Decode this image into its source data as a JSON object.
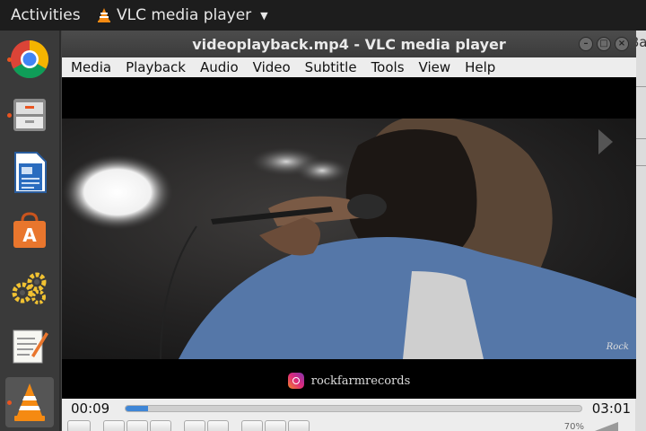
{
  "topbar": {
    "activities": "Activities",
    "app_name": "VLC media player"
  },
  "dock": {
    "items": [
      {
        "icon": "chrome-icon"
      },
      {
        "icon": "file-cabinet-icon"
      },
      {
        "icon": "writer-document-icon"
      },
      {
        "icon": "software-store-icon"
      },
      {
        "icon": "gears-icon"
      },
      {
        "icon": "text-editor-icon"
      },
      {
        "icon": "vlc-cone-icon"
      }
    ]
  },
  "background_window": {
    "title_fragment": "Ba"
  },
  "window": {
    "title": "videoplayback.mp4 - VLC media player"
  },
  "menubar": {
    "items": [
      "Media",
      "Playback",
      "Audio",
      "Video",
      "Subtitle",
      "Tools",
      "View",
      "Help"
    ]
  },
  "video": {
    "caption": "rockfarmrecords",
    "watermark": "Rock"
  },
  "playback": {
    "elapsed": "00:09",
    "total": "03:01",
    "progress_fraction": 0.05
  },
  "volume": {
    "label": "70%"
  },
  "colors": {
    "accent": "#e95420",
    "seek_fill": "#3f86d6"
  }
}
